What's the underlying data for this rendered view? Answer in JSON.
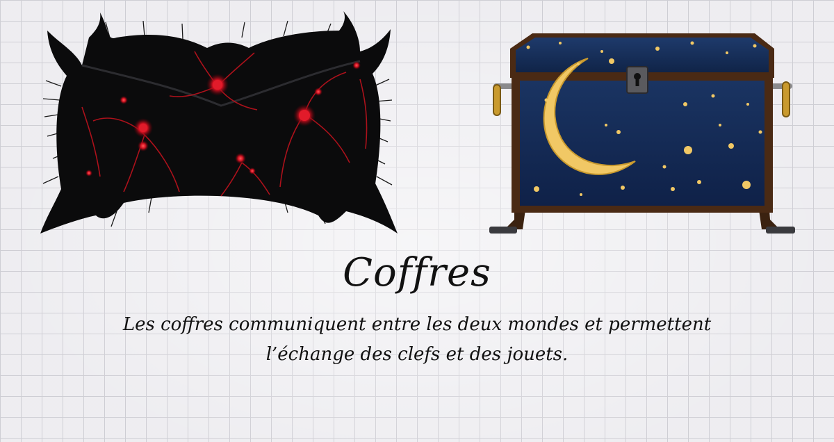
{
  "screen": {
    "title": "Coffres",
    "description_line1": "Les coffres communiquent entre les deux mondes et permettent",
    "description_line2": "l’échange des clefs et des jouets."
  },
  "items": {
    "dark_chest": {
      "icon": "shadow-chest-icon"
    },
    "night_chest": {
      "icon": "night-sky-chest-icon"
    }
  },
  "colors": {
    "background": "#ecebef",
    "grid": "#c9c8cf",
    "shadow_chest_body": "#0b0b0c",
    "shadow_chest_veins": "#c1121f",
    "night_chest_blue": "#152c55",
    "night_chest_wood": "#4a2a14",
    "moon_gold": "#f1c865"
  }
}
